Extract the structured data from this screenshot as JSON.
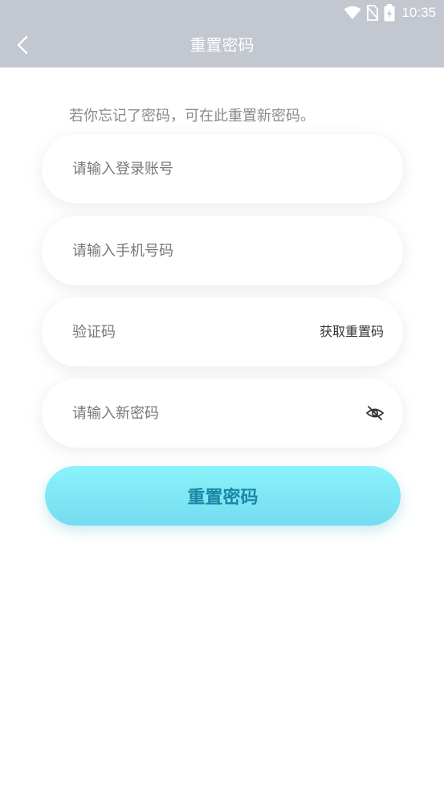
{
  "status_bar": {
    "time": "10:35",
    "icons": [
      "wifi-icon",
      "no-sim-icon",
      "battery-charging-icon"
    ]
  },
  "nav": {
    "title": "重置密码",
    "back_icon": "chevron-left-icon"
  },
  "form": {
    "hint": "若你忘记了密码，可在此重置新密码。",
    "account": {
      "value": "",
      "placeholder": "请输入登录账号"
    },
    "phone": {
      "value": "",
      "placeholder": "请输入手机号码"
    },
    "code": {
      "value": "",
      "placeholder": "验证码",
      "action_label": "获取重置码"
    },
    "new_password": {
      "value": "",
      "placeholder": "请输入新密码",
      "toggle_icon": "eye-off-icon"
    },
    "submit_label": "重置密码"
  },
  "colors": {
    "header_bg": "#c2c7d0",
    "button_gradient_top": "#8af3fb",
    "button_gradient_bottom": "#74dcef",
    "button_text": "#1b86a5"
  }
}
